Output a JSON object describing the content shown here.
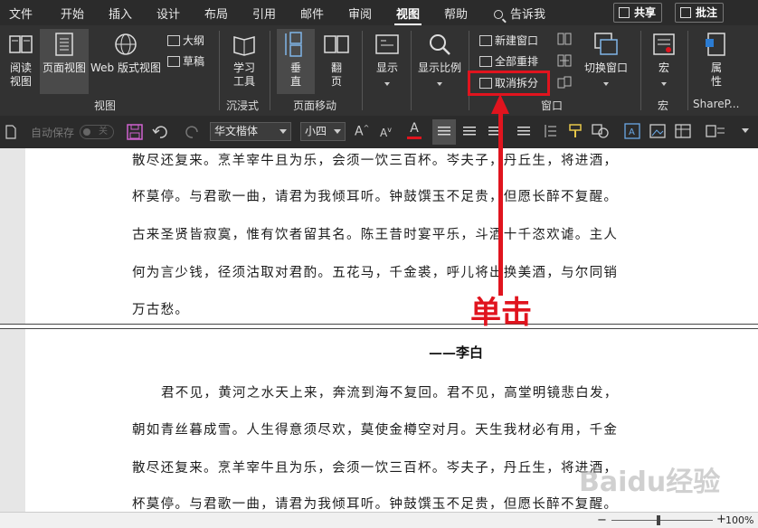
{
  "menubar": {
    "tabs": [
      "文件",
      "开始",
      "插入",
      "设计",
      "布局",
      "引用",
      "邮件",
      "审阅",
      "视图",
      "帮助"
    ],
    "active_tab": "视图",
    "tell_me": "告诉我",
    "share": "共享",
    "comments": "批注"
  },
  "ribbon": {
    "views_group": {
      "read_mode": "阅读\n视图",
      "print_layout": "页面视图",
      "web_layout": "Web 版式视图",
      "outline": "大纲",
      "draft": "草稿",
      "label": "视图"
    },
    "immersive_group": {
      "learning_tools": "学习\n工具",
      "label": "沉浸式"
    },
    "page_movement_group": {
      "vertical": "垂\n直",
      "side_by_side": "翻\n页",
      "label": "页面移动"
    },
    "show_group": {
      "show": "显示"
    },
    "zoom_group": {
      "zoom": "显示比例"
    },
    "window_group": {
      "new_window": "新建窗口",
      "arrange_all": "全部重排",
      "remove_split": "取消拆分",
      "switch_windows": "切换窗口",
      "label": "窗口"
    },
    "macros_group": {
      "macros": "宏",
      "label": "宏"
    },
    "sharepoint_group": {
      "properties": "属\n性",
      "label": "ShareP..."
    }
  },
  "toolbar": {
    "autosave": "自动保存",
    "autosave_state": "关",
    "font_name": "华文楷体",
    "font_size": "小四",
    "font_color": "#e0141e"
  },
  "document": {
    "top_pane_lines": [
      "散尽还复来。烹羊宰牛且为乐，会须一饮三百杯。岑夫子，丹丘生，将进酒，",
      "杯莫停。与君歌一曲，请君为我倾耳听。钟鼓馔玉不足贵，但愿长醉不复醒。",
      "古来圣贤皆寂寞，惟有饮者留其名。陈王昔时宴平乐，斗酒十千恣欢谑。主人",
      "何为言少钱，径须沽取对君酌。五花马，千金裘，呼儿将出换美酒，与尔同销",
      "万古愁。"
    ],
    "author": "——李白",
    "bottom_pane_lines": [
      "君不见，黄河之水天上来，奔流到海不复回。君不见，高堂明镜悲白发，",
      "朝如青丝暮成雪。人生得意须尽欢，莫使金樽空对月。天生我材必有用，千金",
      "散尽还复来。烹羊宰牛且为乐，会须一饮三百杯。岑夫子，丹丘生，将进酒，",
      "杯莫停。与君歌一曲，请君为我倾耳听。钟鼓馔玉不足贵，但愿长醉不复醒。"
    ]
  },
  "annotation": {
    "text": "单击",
    "color": "#e0141e"
  },
  "statusbar": {
    "zoom": "100%"
  },
  "watermark": {
    "text": "Baidu经验"
  }
}
